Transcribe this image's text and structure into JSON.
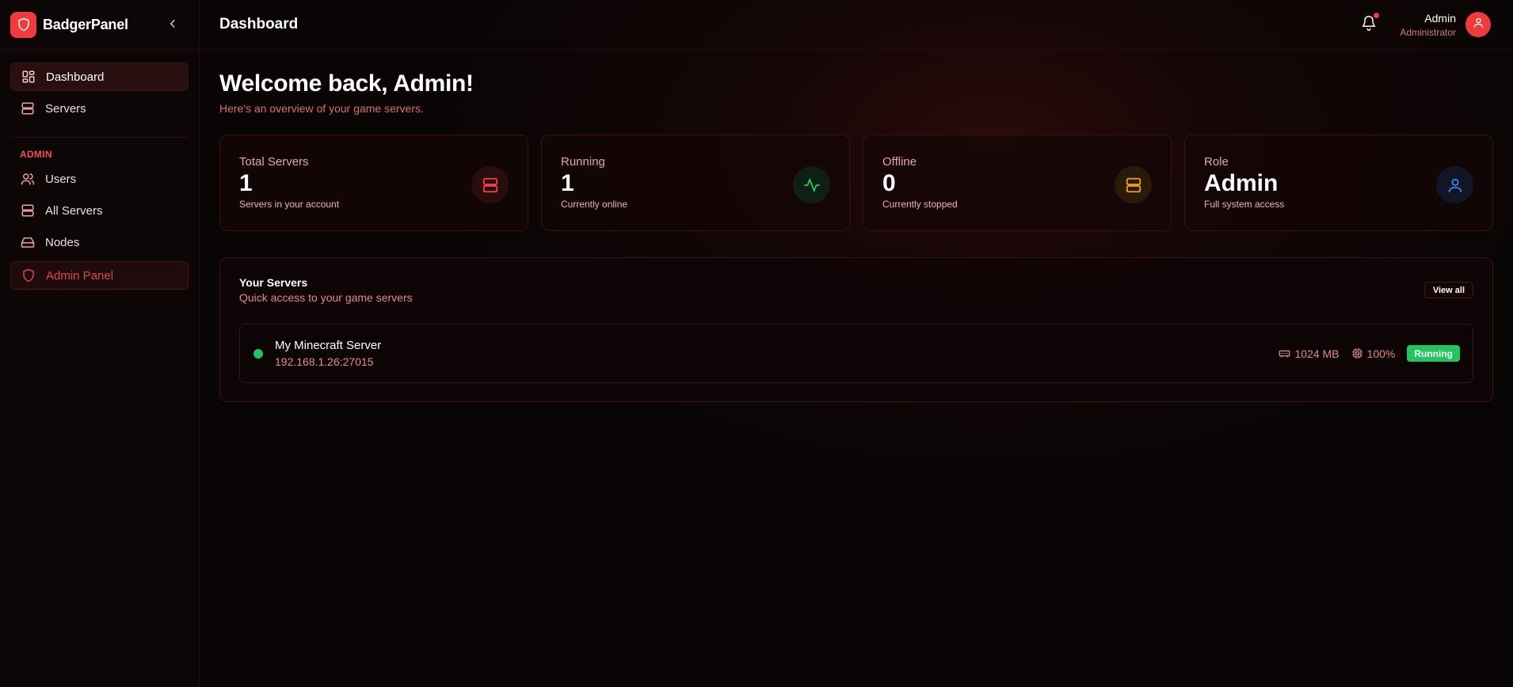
{
  "brand": {
    "name": "BadgerPanel"
  },
  "sidebar": {
    "items": [
      {
        "label": "Dashboard",
        "icon": "dashboard-icon",
        "active": true
      },
      {
        "label": "Servers",
        "icon": "server-icon",
        "active": false
      }
    ],
    "admin_section": {
      "title": "ADMIN",
      "items": [
        {
          "label": "Users",
          "icon": "users-icon"
        },
        {
          "label": "All Servers",
          "icon": "server-icon"
        },
        {
          "label": "Nodes",
          "icon": "hard-drive-icon"
        },
        {
          "label": "Admin Panel",
          "icon": "shield-icon"
        }
      ]
    }
  },
  "header": {
    "title": "Dashboard",
    "user": {
      "name": "Admin",
      "role": "Administrator"
    }
  },
  "welcome": {
    "title": "Welcome back, Admin!",
    "subtitle": "Here's an overview of your game servers."
  },
  "stats": [
    {
      "label": "Total Servers",
      "value": "1",
      "desc": "Servers in your account",
      "icon": "server-icon",
      "color": "#ef4444"
    },
    {
      "label": "Running",
      "value": "1",
      "desc": "Currently online",
      "icon": "activity-icon",
      "color": "#22c55e"
    },
    {
      "label": "Offline",
      "value": "0",
      "desc": "Currently stopped",
      "icon": "server-icon",
      "color": "#f59e0b"
    },
    {
      "label": "Role",
      "value": "Admin",
      "desc": "Full system access",
      "icon": "user-icon",
      "color": "#3b82f6"
    }
  ],
  "servers_panel": {
    "title": "Your Servers",
    "subtitle": "Quick access to your game servers",
    "view_all": "View all",
    "servers": [
      {
        "name": "My Minecraft Server",
        "address": "192.168.1.26:27015",
        "memory": "1024 MB",
        "cpu": "100%",
        "status": "Running"
      }
    ]
  },
  "colors": {
    "accent": "#ef3b3b",
    "running": "#22c55e",
    "offline": "#f59e0b",
    "role": "#3b82f6"
  }
}
